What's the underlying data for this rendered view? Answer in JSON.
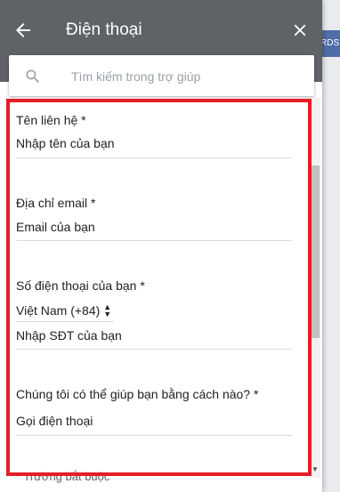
{
  "header": {
    "title": "Điện thoại"
  },
  "search": {
    "placeholder": "Tìm kiếm trong trợ giúp"
  },
  "background": {
    "side_text": "RDS"
  },
  "form": {
    "name_label": "Tên liên hệ *",
    "name_placeholder": "Nhập tên của bạn",
    "email_label": "Địa chỉ email *",
    "email_placeholder": "Email của bạn",
    "phone_label": "Số điện thoại của bạn *",
    "country_value": "Việt Nam (+84)",
    "phone_placeholder": "Nhập SĐT của bạn",
    "help_label": "Chúng tôi có thể giúp bạn bằng cách nào? *",
    "help_value": "Gọi điện thoại",
    "required_note": "* Trường bắt buộc"
  },
  "colors": {
    "header_bg": "#5f6368",
    "highlight_border": "#e41e26"
  },
  "icons": {
    "back": "arrow-left-icon",
    "close": "close-icon",
    "search": "search-icon",
    "select": "updown-arrows-icon"
  }
}
